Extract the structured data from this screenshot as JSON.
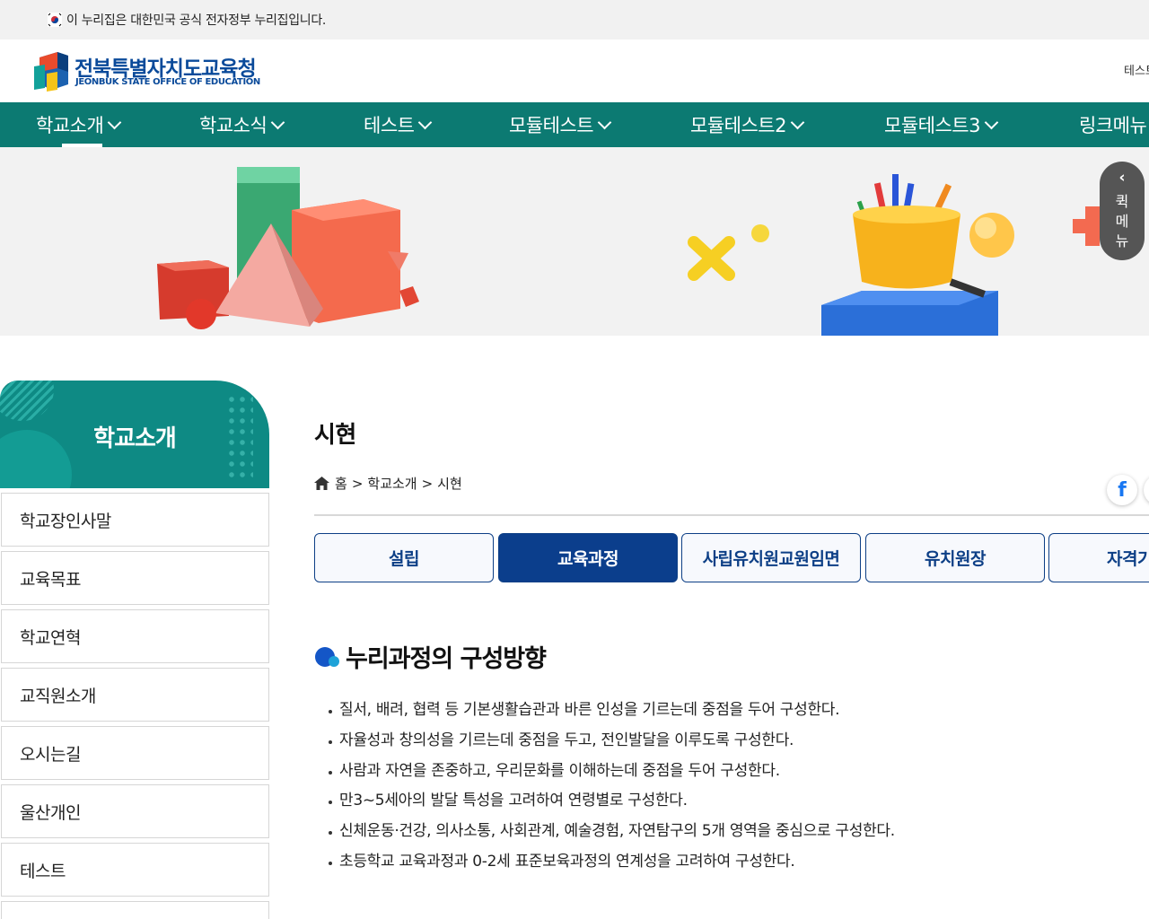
{
  "gov_banner": {
    "text": "이 누리집은 대한민국 공식 전자정부 누리집입니다."
  },
  "header": {
    "logo_ko": "전북특별자치도교육청",
    "logo_en": "JEONBUK STATE OFFICE OF EDUCATION",
    "util_link": "테스트"
  },
  "gnb": {
    "items": [
      {
        "label": "학교소개"
      },
      {
        "label": "학교소식"
      },
      {
        "label": "테스트"
      },
      {
        "label": "모듈테스트"
      },
      {
        "label": "모듈테스트2"
      },
      {
        "label": "모듈테스트3"
      },
      {
        "label": "링크메뉴"
      }
    ]
  },
  "quick_menu": {
    "arrow": "‹",
    "label_lines": [
      "퀵",
      "메",
      "뉴"
    ]
  },
  "sidebar": {
    "title": "학교소개",
    "items": [
      {
        "label": "학교장인사말"
      },
      {
        "label": "교육목표"
      },
      {
        "label": "학교연혁"
      },
      {
        "label": "교직원소개"
      },
      {
        "label": "오시는길"
      },
      {
        "label": "울산개인"
      },
      {
        "label": "테스트"
      },
      {
        "label": ""
      }
    ]
  },
  "content": {
    "page_title": "시현",
    "breadcrumb": {
      "home": "홈",
      "sep": ">",
      "level1": "학교소개",
      "level2": "시현"
    },
    "share_icon": "f",
    "tabs": [
      {
        "label": "설립"
      },
      {
        "label": "교육과정"
      },
      {
        "label": "사립유치원교원임면"
      },
      {
        "label": "유치원장"
      },
      {
        "label": "자격기"
      }
    ],
    "section_title": "누리과정의 구성방향",
    "bullets": [
      "질서, 배려, 협력 등 기본생활습관과 바른 인성을 기르는데 중점을 두어 구성한다.",
      "자율성과 창의성을 기르는데 중점을 두고, 전인발달을 이루도록 구성한다.",
      "사람과 자연을 존중하고, 우리문화를 이해하는데 중점을 두어 구성한다.",
      "만3~5세아의 발달 특성을 고려하여 연령별로 구성한다.",
      "신체운동·건강, 의사소통, 사회관계, 예술경험, 자연탐구의 5개 영역을 중심으로 구성한다.",
      "초등학교 교육과정과 0-2세 표준보육과정의 연계성을 고려하여 구성한다."
    ]
  },
  "colors": {
    "gnb_bg": "#0c7a72",
    "sidebar_head": "#0e8a84",
    "tab_active": "#0b3e8c",
    "brand_blue": "#0a4a9a"
  }
}
